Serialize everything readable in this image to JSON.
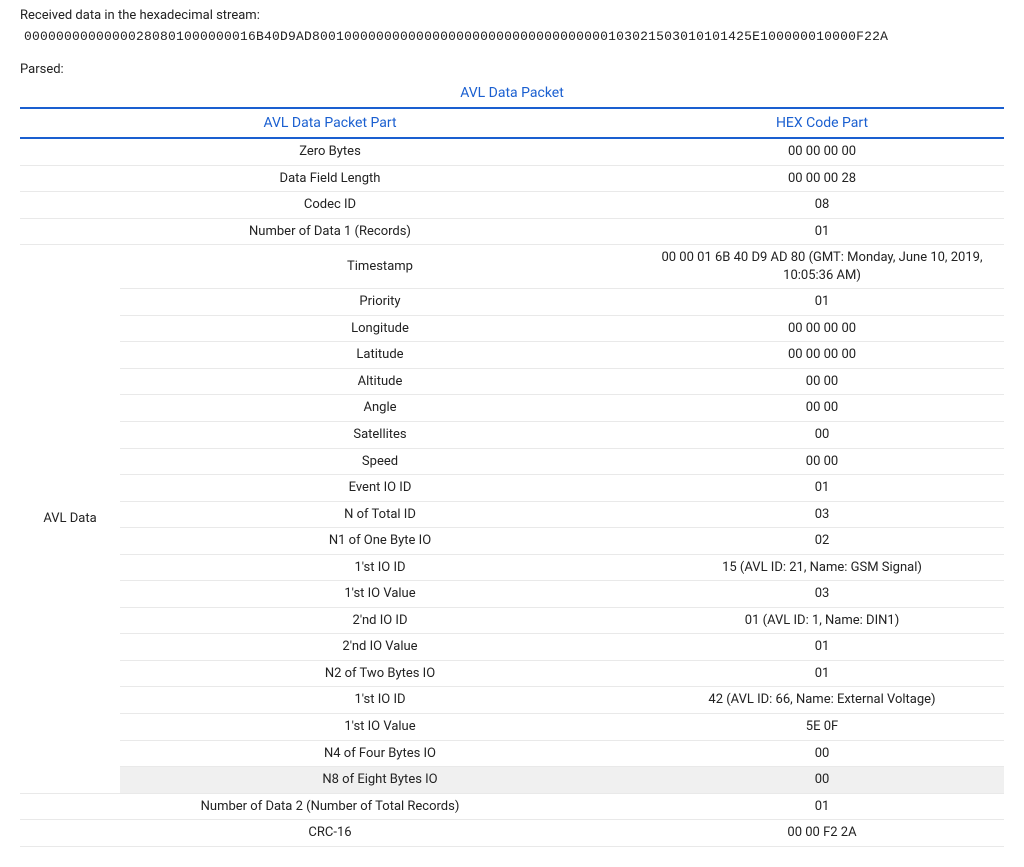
{
  "intro_label": "Received data in the hexadecimal stream:",
  "hex_stream": "00000000000000280801000000016B40D9AD8001000000000000000000000000000000000103021503010101425E100000010000F22A",
  "parsed_label": "Parsed:",
  "table": {
    "caption": "AVL Data Packet",
    "col_part": "AVL Data Packet Part",
    "col_hex": "HEX Code Part",
    "group_avl_data": "AVL Data",
    "rows": [
      {
        "part": "Zero Bytes",
        "hex": "00 00 00 00",
        "group": "top"
      },
      {
        "part": "Data Field Length",
        "hex": "00 00 00 28",
        "group": "top"
      },
      {
        "part": "Codec ID",
        "hex": "08",
        "group": "top"
      },
      {
        "part": "Number of Data 1 (Records)",
        "hex": "01",
        "group": "top"
      },
      {
        "part": "Timestamp",
        "hex": "00 00 01 6B 40 D9 AD 80 (GMT: Monday, June 10, 2019, 10:05:36 AM)",
        "group": "avl"
      },
      {
        "part": "Priority",
        "hex": "01",
        "group": "avl"
      },
      {
        "part": "Longitude",
        "hex": "00 00 00 00",
        "group": "avl"
      },
      {
        "part": "Latitude",
        "hex": "00 00 00 00",
        "group": "avl"
      },
      {
        "part": "Altitude",
        "hex": "00 00",
        "group": "avl"
      },
      {
        "part": "Angle",
        "hex": "00 00",
        "group": "avl"
      },
      {
        "part": "Satellites",
        "hex": "00",
        "group": "avl"
      },
      {
        "part": "Speed",
        "hex": "00 00",
        "group": "avl"
      },
      {
        "part": "Event IO ID",
        "hex": "01",
        "group": "avl"
      },
      {
        "part": "N of Total ID",
        "hex": "03",
        "group": "avl"
      },
      {
        "part": "N1 of One Byte IO",
        "hex": "02",
        "group": "avl"
      },
      {
        "part": "1'st IO ID",
        "hex": "15 (AVL ID: 21, Name: GSM Signal)",
        "group": "avl"
      },
      {
        "part": "1'st IO Value",
        "hex": "03",
        "group": "avl"
      },
      {
        "part": "2'nd IO ID",
        "hex": "01 (AVL ID: 1, Name: DIN1)",
        "group": "avl"
      },
      {
        "part": "2'nd IO Value",
        "hex": "01",
        "group": "avl"
      },
      {
        "part": "N2 of Two Bytes IO",
        "hex": "01",
        "group": "avl"
      },
      {
        "part": "1'st IO ID",
        "hex": "42 (AVL ID: 66, Name: External Voltage)",
        "group": "avl"
      },
      {
        "part": "1'st IO Value",
        "hex": "5E 0F",
        "group": "avl"
      },
      {
        "part": "N4 of Four Bytes IO",
        "hex": "00",
        "group": "avl"
      },
      {
        "part": "N8 of Eight Bytes IO",
        "hex": "00",
        "group": "avl",
        "shade": true
      },
      {
        "part": "Number of Data 2 (Number of Total Records)",
        "hex": "01",
        "group": "bottom"
      },
      {
        "part": "CRC-16",
        "hex": "00 00 F2 2A",
        "group": "bottom"
      }
    ]
  }
}
